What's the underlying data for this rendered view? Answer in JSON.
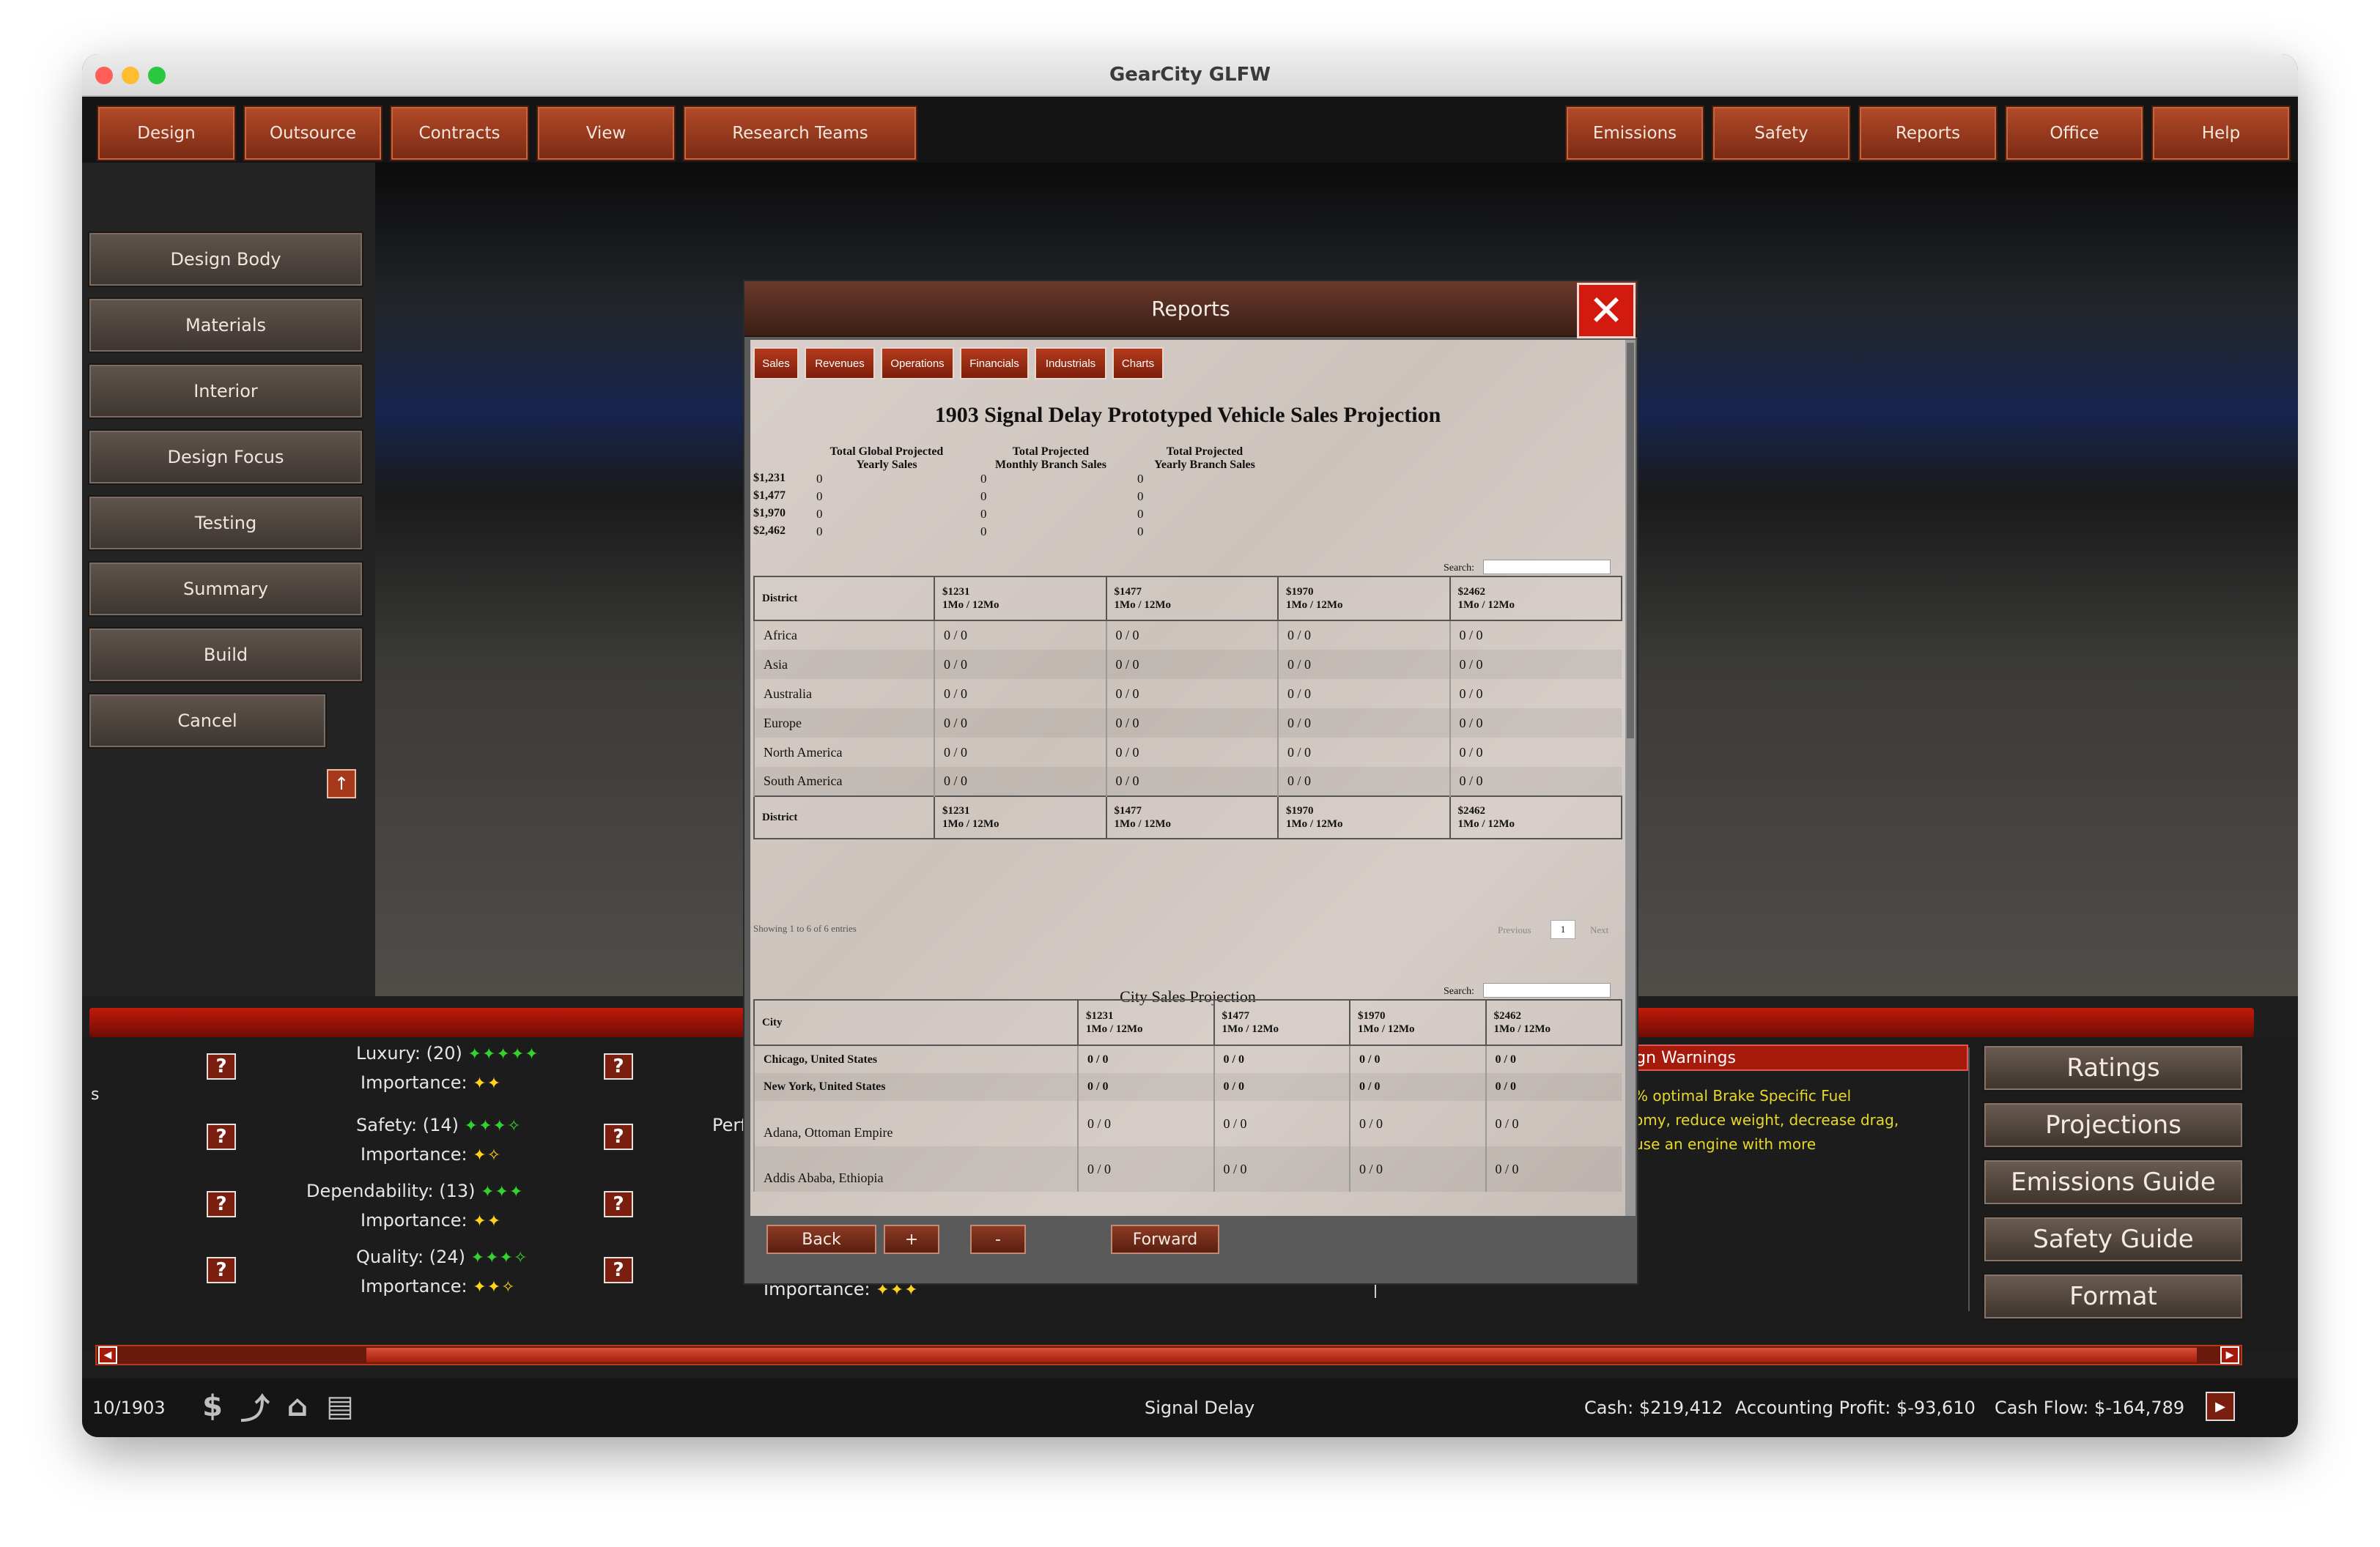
{
  "window": {
    "title": "GearCity GLFW"
  },
  "menu_left": [
    "Design",
    "Outsource",
    "Contracts",
    "View",
    "Research  Teams"
  ],
  "menu_right": [
    "Emissions",
    "Safety",
    "Reports",
    "Office",
    "Help"
  ],
  "left_menu": [
    "Design  Body",
    "Materials",
    "Interior",
    "Design  Focus",
    "Testing",
    "Summary",
    "Build",
    "Cancel"
  ],
  "stats": [
    {
      "label": "Luxury:  (20)",
      "stars": "✦✦✦✦✦",
      "importance_label": "Importance:",
      "importance_stars": "✦✦"
    },
    {
      "label": "Safety:    (14)",
      "stars": "✦✦✦✧",
      "importance_label": "Importance:",
      "importance_stars": "✦✧"
    },
    {
      "label": "Dependability:  (13)",
      "stars": "✦✦✦",
      "importance_label": "Importance:",
      "importance_stars": "✦✦"
    },
    {
      "label": "Quality:  (24)",
      "stars": "✦✦✦✧",
      "importance_label": "Importance:",
      "importance_stars": "✦✦✧"
    }
  ],
  "partial_left_s": "s",
  "partial_perf": "Perf",
  "partial_importance": "Importance:",
  "partial_importance_stars": "✦✦✦",
  "warnings": {
    "header": "ign  Warnings",
    "lines": [
      "%  optimal  Brake  Specific  Fuel",
      "omy,  reduce  weight,  decrease  drag,",
      "use  an  engine  with  more"
    ]
  },
  "right_buttons": [
    "Ratings",
    "Projections",
    "Emissions  Guide",
    "Safety  Guide",
    "Format"
  ],
  "status": {
    "date": "10/1903",
    "vehicle": "Signal  Delay",
    "cash": "Cash:  $219,412",
    "profit": "Accounting  Profit:  $-93,610",
    "cashflow": "Cash  Flow:  $-164,789"
  },
  "icons": [
    "dollar-icon",
    "chart-icon",
    "bank-icon",
    "bill-icon"
  ],
  "modal": {
    "title": "Reports",
    "tabs": [
      "Sales",
      "Revenues",
      "Operations",
      "Financials",
      "Industrials",
      "Charts"
    ],
    "report_title": "1903 Signal Delay Prototyped Vehicle Sales Projection",
    "summary_headers": [
      "Total Global Projected\nYearly Sales",
      "Total Projected\nMonthly Branch Sales",
      "Total Projected\nYearly Branch Sales"
    ],
    "summary_rows": [
      {
        "price": "$1,231",
        "global": "0",
        "monthly": "0",
        "yearly": "0"
      },
      {
        "price": "$1,477",
        "global": "0",
        "monthly": "0",
        "yearly": "0"
      },
      {
        "price": "$1,970",
        "global": "0",
        "monthly": "0",
        "yearly": "0"
      },
      {
        "price": "$2,462",
        "global": "0",
        "monthly": "0",
        "yearly": "0"
      }
    ],
    "search_label": "Search:",
    "district_table": {
      "first_col": "District",
      "columns": [
        {
          "price": "$1231",
          "period": "1Mo / 12Mo"
        },
        {
          "price": "$1477",
          "period": "1Mo / 12Mo"
        },
        {
          "price": "$1970",
          "period": "1Mo / 12Mo"
        },
        {
          "price": "$2462",
          "period": "1Mo / 12Mo"
        }
      ],
      "rows": [
        {
          "name": "Africa",
          "cells": [
            "0 / 0",
            "0 / 0",
            "0 / 0",
            "0 / 0"
          ]
        },
        {
          "name": "Asia",
          "cells": [
            "0 / 0",
            "0 / 0",
            "0 / 0",
            "0 / 0"
          ]
        },
        {
          "name": "Australia",
          "cells": [
            "0 / 0",
            "0 / 0",
            "0 / 0",
            "0 / 0"
          ]
        },
        {
          "name": "Europe",
          "cells": [
            "0 / 0",
            "0 / 0",
            "0 / 0",
            "0 / 0"
          ]
        },
        {
          "name": "North America",
          "cells": [
            "0 / 0",
            "0 / 0",
            "0 / 0",
            "0 / 0"
          ]
        },
        {
          "name": "South America",
          "cells": [
            "0 / 0",
            "0 / 0",
            "0 / 0",
            "0 / 0"
          ]
        }
      ]
    },
    "showing": "Showing 1 to 6 of 6 entries",
    "pager": {
      "previous": "Previous",
      "page": "1",
      "next": "Next"
    },
    "city_title": "City Sales Projection",
    "city_table": {
      "first_col": "City",
      "rows": [
        {
          "name": "Chicago, United States",
          "cells": [
            "0 / 0",
            "0 / 0",
            "0 / 0",
            "0 / 0"
          ]
        },
        {
          "name": "New York, United States",
          "cells": [
            "0 / 0",
            "0 / 0",
            "0 / 0",
            "0 / 0"
          ]
        },
        {
          "name": "Adana, Ottoman Empire",
          "cells": [
            "0 / 0",
            "0 / 0",
            "0 / 0",
            "0 / 0"
          ]
        },
        {
          "name": "Addis Ababa, Ethiopia",
          "cells": [
            "0 / 0",
            "0 / 0",
            "0 / 0",
            "0 / 0"
          ]
        }
      ]
    },
    "footer": {
      "back": "Back",
      "plus": "+",
      "minus": "-",
      "forward": "Forward"
    }
  }
}
